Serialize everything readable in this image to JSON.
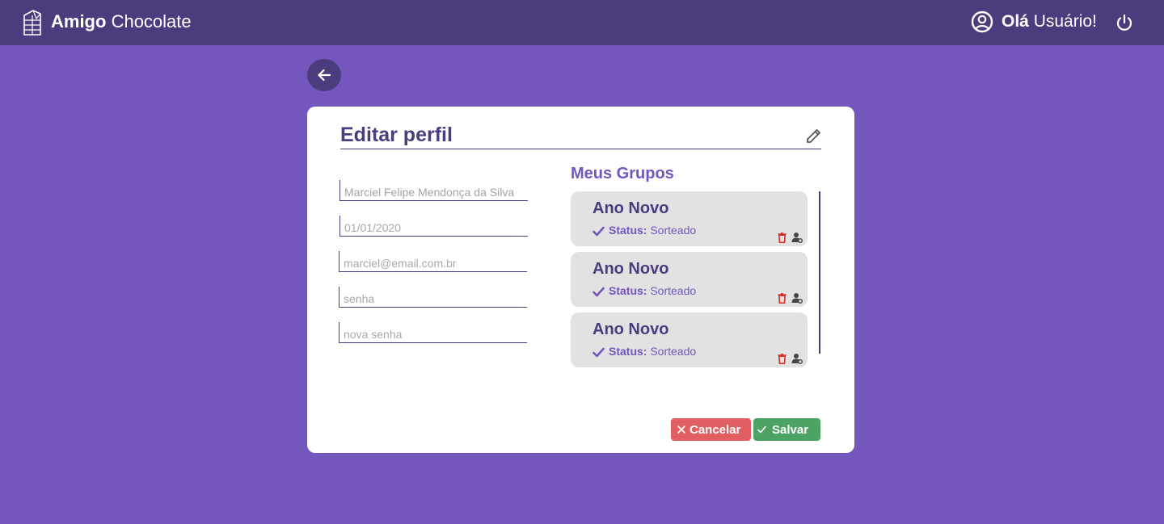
{
  "header": {
    "brand_bold": "Amigo",
    "brand_rest": " Chocolate",
    "greeting_bold": "Olá",
    "greeting_rest": " Usuário!"
  },
  "icons": {
    "logo": "chocolate-bar-icon",
    "user": "user-circle-icon",
    "power": "power-icon",
    "back": "arrow-left-icon",
    "edit": "pencil-icon",
    "check": "check-icon",
    "trash": "trash-icon",
    "person": "person-gear-icon",
    "cancel": "close-icon",
    "save": "check-icon"
  },
  "colors": {
    "background": "#7357bf",
    "header": "#4b3c7d",
    "card": "#ffffff",
    "group_card": "#e2e2e2",
    "cancel": "#e25f61",
    "save": "#4da363",
    "trash": "#d32f2f"
  },
  "profile": {
    "title": "Editar perfil",
    "fields": {
      "name": {
        "value": "Marciel Felipe Mendonça da Silva",
        "placeholder": ""
      },
      "birthdate": {
        "value": "",
        "placeholder": "01/01/2020"
      },
      "email": {
        "value": "",
        "placeholder": "marciel@email.com.br"
      },
      "password": {
        "value": "",
        "placeholder": "senha"
      },
      "new_password": {
        "value": "",
        "placeholder": "nova senha"
      }
    }
  },
  "groups": {
    "title": "Meus Grupos",
    "items": [
      {
        "name": "Ano Novo",
        "status_label": "Status:",
        "status_value": "Sorteado"
      },
      {
        "name": "Ano Novo",
        "status_label": "Status:",
        "status_value": "Sorteado"
      },
      {
        "name": "Ano Novo",
        "status_label": "Status:",
        "status_value": "Sorteado"
      }
    ]
  },
  "actions": {
    "cancel": "Cancelar",
    "save": "Salvar"
  }
}
